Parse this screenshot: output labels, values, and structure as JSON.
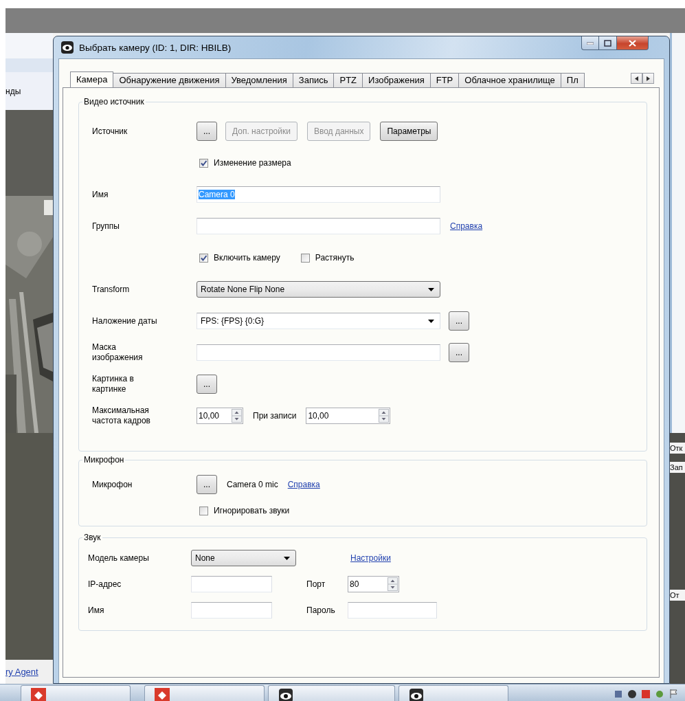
{
  "desktop": {
    "side_text": "нды",
    "side_link": "ry Agent",
    "right_texts": [
      "Отк",
      "Зап",
      "От"
    ]
  },
  "dialog": {
    "title": "Выбрать камеру (ID: 1, DIR: HBILB)"
  },
  "tabs": [
    {
      "label": "Камера",
      "selected": true
    },
    {
      "label": "Обнаружение движения",
      "selected": false
    },
    {
      "label": "Уведомления",
      "selected": false
    },
    {
      "label": "Запись",
      "selected": false
    },
    {
      "label": "PTZ",
      "selected": false
    },
    {
      "label": "Изображения",
      "selected": false
    },
    {
      "label": "FTP",
      "selected": false
    },
    {
      "label": "Облачное хранилище",
      "selected": false
    },
    {
      "label": "Пл",
      "selected": false
    }
  ],
  "groups": [
    {
      "legend": "Видео источник",
      "kind": "form",
      "rows": [
        {
          "label": "Источник",
          "controls": [
            {
              "kind": "button",
              "text": "...",
              "disabled": false
            },
            {
              "kind": "button",
              "text": "Доп. настройки",
              "disabled": true
            },
            {
              "kind": "button",
              "text": "Ввод данных",
              "disabled": true
            },
            {
              "kind": "button",
              "text": "Параметры",
              "disabled": false
            }
          ]
        },
        {
          "controls": [
            {
              "kind": "check",
              "text": "Изменение размера",
              "checked": true
            }
          ]
        },
        {
          "label": "Имя",
          "controls": [
            {
              "kind": "field",
              "value": "Camera 0",
              "value_selected": true
            }
          ]
        },
        {
          "label": "Группы",
          "controls": [
            {
              "kind": "field"
            },
            {
              "kind": "link",
              "text": "Справка"
            }
          ]
        },
        {
          "controls": [
            {
              "kind": "check",
              "text": "Включить камеру",
              "checked": true
            },
            {
              "kind": "check",
              "text": "Растянуть",
              "checked": false
            }
          ]
        },
        {
          "label": "Transform",
          "controls": [
            {
              "kind": "dropdown",
              "value": "Rotate None Flip None"
            }
          ]
        },
        {
          "label": "Наложение даты",
          "controls": [
            {
              "kind": "combo",
              "value": "FPS: {FPS} {0:G}"
            },
            {
              "kind": "button",
              "text": "...",
              "disabled": false
            }
          ]
        },
        {
          "label": "Маска\nизображения",
          "controls": [
            {
              "kind": "field"
            },
            {
              "kind": "button",
              "text": "...",
              "disabled": false
            }
          ]
        },
        {
          "label": "Картинка в\nкартинке",
          "controls": [
            {
              "kind": "button",
              "text": "...",
              "disabled": false
            }
          ]
        },
        {
          "label": "Максимальная\nчастота кадров",
          "controls": [
            {
              "kind": "spin",
              "value": "10,00"
            },
            {
              "kind": "text",
              "text": "При записи"
            },
            {
              "kind": "spin",
              "value": "10,00"
            }
          ]
        }
      ]
    },
    {
      "legend": "Микрофон",
      "kind": "form",
      "rows": [
        {
          "label": "Микрофон",
          "controls": [
            {
              "kind": "button",
              "text": "...",
              "disabled": false
            },
            {
              "kind": "value",
              "text": "Camera 0 mic"
            },
            {
              "kind": "link",
              "text": "Справка"
            }
          ]
        },
        {
          "controls": [
            {
              "kind": "check",
              "text": "Игнорировать звуки",
              "checked": false
            }
          ]
        }
      ]
    },
    {
      "legend": "Звук",
      "kind": "grid",
      "rows": [
        {
          "label": "Модель камеры",
          "controls": [
            {
              "kind": "dropdown",
              "value": "None"
            },
            {
              "kind": "link",
              "text": "Настройки"
            }
          ]
        },
        {
          "label": "IP-адрес",
          "controls": [
            {
              "kind": "field"
            },
            {
              "kind": "text",
              "text": "Порт"
            },
            {
              "kind": "spin",
              "value": "80"
            }
          ]
        },
        {
          "label": "Имя",
          "controls": [
            {
              "kind": "field"
            },
            {
              "kind": "text",
              "text": "Пароль"
            },
            {
              "kind": "field"
            }
          ]
        }
      ]
    }
  ]
}
